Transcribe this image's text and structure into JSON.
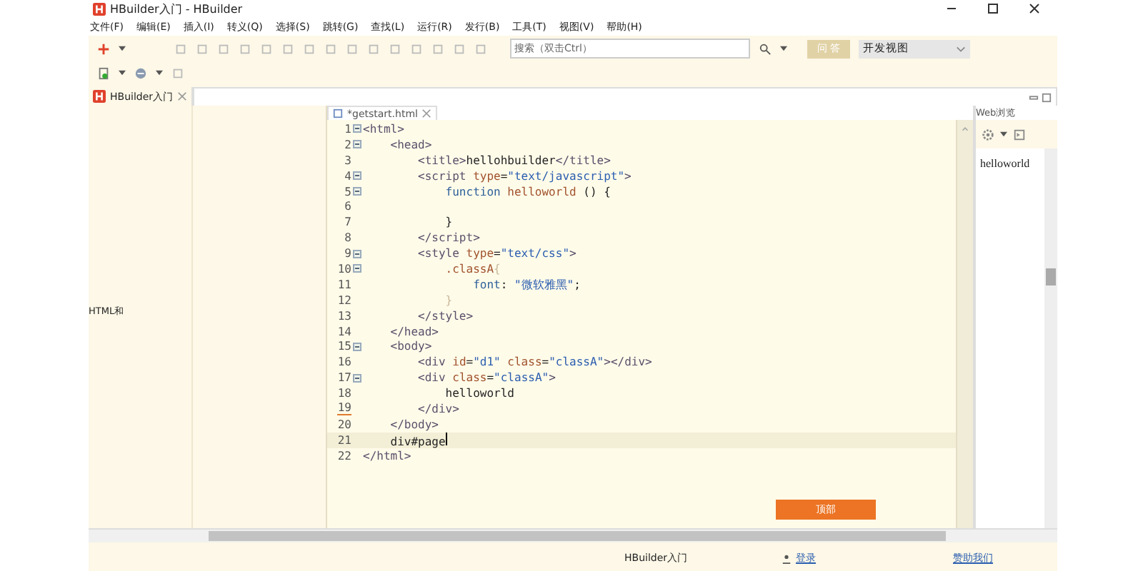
{
  "window": {
    "title": "HBuilder入门 - HBuilder"
  },
  "menu": [
    "文件(F)",
    "编辑(E)",
    "插入(I)",
    "转义(Q)",
    "选择(S)",
    "跳转(G)",
    "查找(L)",
    "运行(R)",
    "发行(B)",
    "工具(T)",
    "视图(V)",
    "帮助(H)"
  ],
  "search": {
    "placeholder": "搜索（双击Ctrl）"
  },
  "qa_button": "问 答",
  "view_select": {
    "value": "开发视图"
  },
  "project_tab": {
    "label": "HBuilder入门"
  },
  "project_panel": {
    "text": "HTML和"
  },
  "editor": {
    "tab": "*getstart.html",
    "lines": [
      {
        "number": "1",
        "fold": true,
        "current": false,
        "modified": false,
        "tokens": [
          {
            "kind": "tag",
            "text": "<html>"
          }
        ]
      },
      {
        "number": "2",
        "fold": true,
        "current": false,
        "modified": false,
        "tokens": [
          {
            "kind": "tag",
            "text": "    <head>"
          }
        ]
      },
      {
        "number": "3",
        "fold": false,
        "current": false,
        "modified": false,
        "tokens": [
          {
            "kind": "tag",
            "text": "        <title>"
          },
          {
            "kind": "plain",
            "text": "hellohbuilder"
          },
          {
            "kind": "tag",
            "text": "</title>"
          }
        ]
      },
      {
        "number": "4",
        "fold": true,
        "current": false,
        "modified": false,
        "tokens": [
          {
            "kind": "tag",
            "text": "        <script "
          },
          {
            "kind": "attr",
            "text": "type"
          },
          {
            "kind": "plain",
            "text": "="
          },
          {
            "kind": "string",
            "text": "\"text/javascript\""
          },
          {
            "kind": "tag",
            "text": ">"
          }
        ]
      },
      {
        "number": "5",
        "fold": true,
        "current": false,
        "modified": false,
        "tokens": [
          {
            "kind": "keyword",
            "text": "            function "
          },
          {
            "kind": "attr",
            "text": "helloworld"
          },
          {
            "kind": "plain",
            "text": " () {"
          }
        ]
      },
      {
        "number": "6",
        "fold": false,
        "current": false,
        "modified": false
      },
      {
        "number": "7",
        "fold": false,
        "current": false,
        "modified": false,
        "tokens": [
          {
            "kind": "plain",
            "text": "            }"
          }
        ]
      },
      {
        "number": "8",
        "fold": false,
        "current": false,
        "modified": false,
        "tokens": [
          {
            "kind": "tag",
            "text": "        </script>"
          }
        ]
      },
      {
        "number": "9",
        "fold": true,
        "current": false,
        "modified": false,
        "tokens": [
          {
            "kind": "tag",
            "text": "        <style "
          },
          {
            "kind": "attr",
            "text": "type"
          },
          {
            "kind": "plain",
            "text": "="
          },
          {
            "kind": "string",
            "text": "\"text/css\""
          },
          {
            "kind": "tag",
            "text": ">"
          }
        ]
      },
      {
        "number": "10",
        "fold": true,
        "current": false,
        "modified": false,
        "tokens": [
          {
            "kind": "attr",
            "text": "            .classA"
          },
          {
            "kind": "faint",
            "text": "{"
          }
        ]
      },
      {
        "number": "11",
        "fold": false,
        "current": false,
        "modified": false,
        "tokens": [
          {
            "kind": "keyword",
            "text": "                font"
          },
          {
            "kind": "plain",
            "text": ": "
          },
          {
            "kind": "string",
            "text": "\"微软雅黑\""
          },
          {
            "kind": "plain",
            "text": ";"
          }
        ]
      },
      {
        "number": "12",
        "fold": false,
        "current": false,
        "modified": false,
        "tokens": [
          {
            "kind": "faint",
            "text": "            }"
          }
        ]
      },
      {
        "number": "13",
        "fold": false,
        "current": false,
        "modified": false,
        "tokens": [
          {
            "kind": "tag",
            "text": "        </style>"
          }
        ]
      },
      {
        "number": "14",
        "fold": false,
        "current": false,
        "modified": false,
        "tokens": [
          {
            "kind": "tag",
            "text": "    </head>"
          }
        ]
      },
      {
        "number": "15",
        "fold": true,
        "current": false,
        "modified": false,
        "tokens": [
          {
            "kind": "tag",
            "text": "    <body>"
          }
        ]
      },
      {
        "number": "16",
        "fold": false,
        "current": false,
        "modified": false,
        "tokens": [
          {
            "kind": "tag",
            "text": "        <div "
          },
          {
            "kind": "attr",
            "text": "id"
          },
          {
            "kind": "plain",
            "text": "="
          },
          {
            "kind": "string",
            "text": "\"d1\""
          },
          {
            "kind": "attr",
            "text": " class"
          },
          {
            "kind": "plain",
            "text": "="
          },
          {
            "kind": "string",
            "text": "\"classA\""
          },
          {
            "kind": "tag",
            "text": "></div>"
          }
        ]
      },
      {
        "number": "17",
        "fold": true,
        "current": false,
        "modified": false,
        "tokens": [
          {
            "kind": "tag",
            "text": "        <div "
          },
          {
            "kind": "attr",
            "text": "class"
          },
          {
            "kind": "plain",
            "text": "="
          },
          {
            "kind": "string",
            "text": "\"classA\""
          },
          {
            "kind": "tag",
            "text": ">"
          }
        ]
      },
      {
        "number": "18",
        "fold": false,
        "current": false,
        "modified": false,
        "tokens": [
          {
            "kind": "plain",
            "text": "            helloworld"
          }
        ]
      },
      {
        "number": "19",
        "fold": false,
        "current": false,
        "modified": true,
        "tokens": [
          {
            "kind": "tag",
            "text": "        </div>"
          }
        ]
      },
      {
        "number": "20",
        "fold": false,
        "current": false,
        "modified": false,
        "tokens": [
          {
            "kind": "tag",
            "text": "    </body>"
          }
        ]
      },
      {
        "number": "21",
        "fold": false,
        "current": true,
        "modified": false,
        "tokens": [
          {
            "kind": "plain",
            "text": "    div#page"
          }
        ]
      },
      {
        "number": "22",
        "fold": false,
        "current": false,
        "modified": false,
        "tokens": [
          {
            "kind": "tag",
            "text": "</html>"
          }
        ]
      }
    ],
    "top_button": "顶部"
  },
  "preview": {
    "tab": "Web浏览",
    "content": "helloworld"
  },
  "status_bar": {
    "project": "HBuilder入门",
    "login": "登录",
    "sponsor": "赞助我们"
  }
}
